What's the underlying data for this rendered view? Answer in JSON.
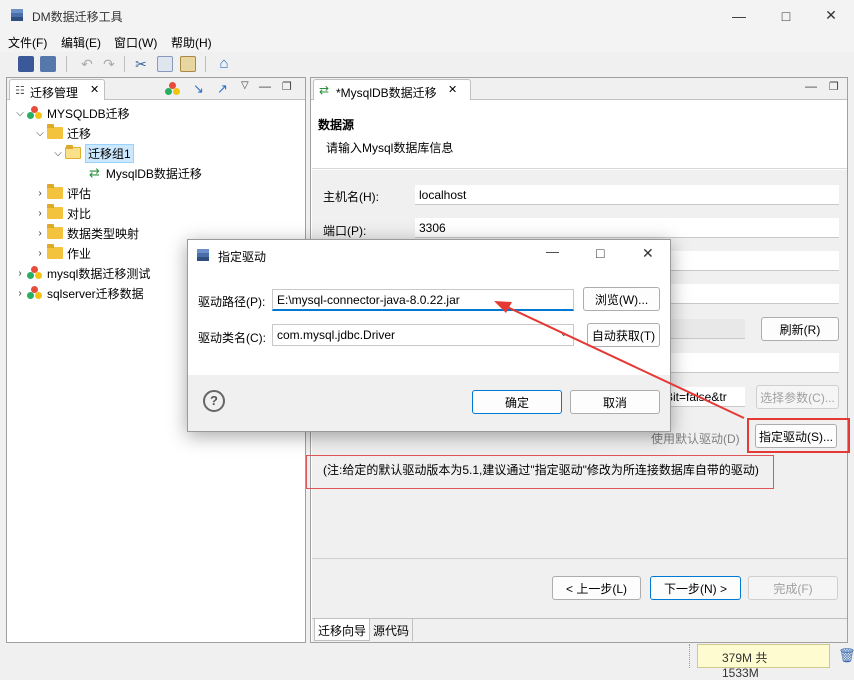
{
  "app": {
    "title": "DM数据迁移工具"
  },
  "menu": [
    "文件(F)",
    "编辑(E)",
    "窗口(W)",
    "帮助(H)"
  ],
  "left_panel": {
    "tab": "迁移管理",
    "tree": [
      {
        "label": "MYSQLDB迁移"
      },
      {
        "label": "迁移"
      },
      {
        "label": "迁移组1"
      },
      {
        "label": "MysqlDB数据迁移"
      },
      {
        "label": "评估"
      },
      {
        "label": "对比"
      },
      {
        "label": "数据类型映射"
      },
      {
        "label": "作业"
      },
      {
        "label": "mysql数据迁移测试"
      },
      {
        "label": "sqlserver迁移数据"
      }
    ]
  },
  "editor": {
    "tab": "*MysqlDB数据迁移",
    "header_title": "数据源",
    "header_sub": "请输入Mysql数据库信息",
    "host_label": "主机名(H):",
    "host_value": "localhost",
    "port_label": "端口(P):",
    "port_value": "3306",
    "refresh_button": "刷新(R)",
    "url_tail": "Bit=false&tr",
    "select_params_button": "选择参数(C)...",
    "use_default_driver": "使用默认驱动(D)",
    "specify_driver_button": "指定驱动(S)...",
    "note": "(注:给定的默认驱动版本为5.1,建议通过\"指定驱动\"修改为所连接数据库自带的驱动)",
    "prev_button": "< 上一步(L)",
    "next_button": "下一步(N) >",
    "finish_button": "完成(F)",
    "bottom_tabs": [
      "迁移向导",
      "源代码"
    ]
  },
  "dialog": {
    "title": "指定驱动",
    "path_label": "驱动路径(P):",
    "path_value": "E:\\mysql-connector-java-8.0.22.jar",
    "browse_button": "浏览(W)...",
    "class_label": "驱动类名(C):",
    "class_value": "com.mysql.jdbc.Driver",
    "auto_button": "自动获取(T)",
    "ok_button": "确定",
    "cancel_button": "取消"
  },
  "status": {
    "memory": "379M 共 1533M"
  },
  "colors": {
    "accent": "#0078d4",
    "annotation_red": "#e53935"
  }
}
